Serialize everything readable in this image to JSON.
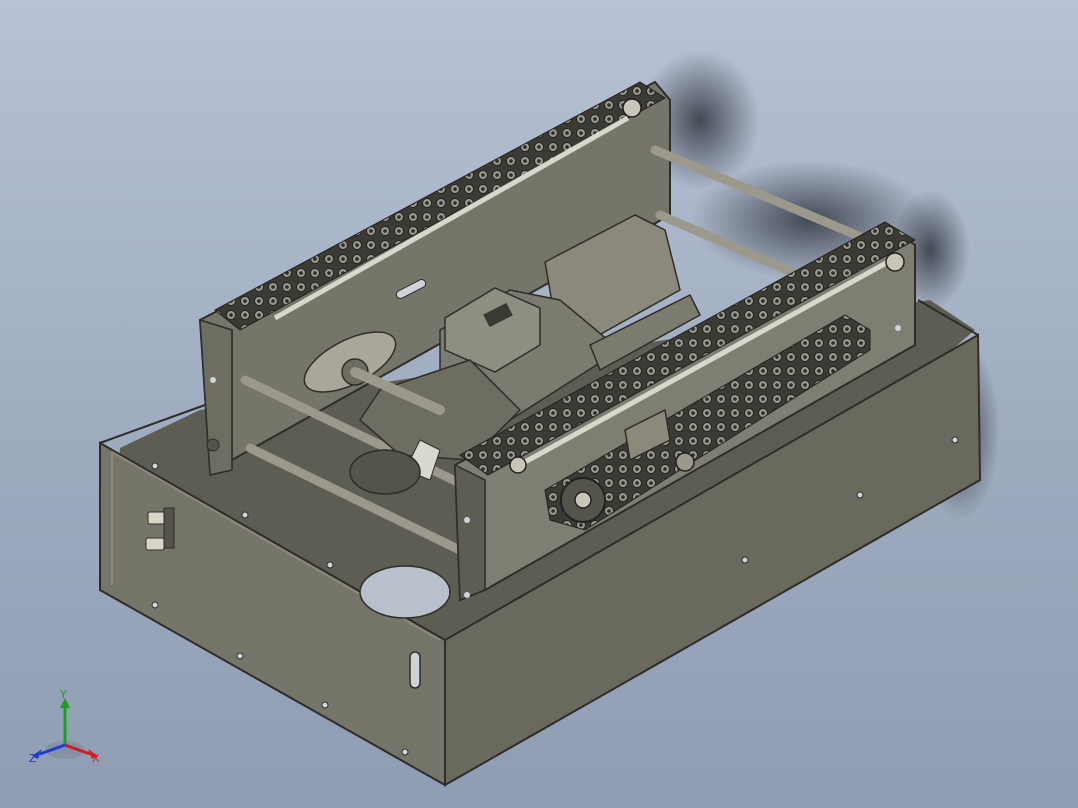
{
  "viewport": {
    "background_top": "#b7c2d4",
    "background_bottom": "#8f9db3",
    "model_color": "#6e6d62",
    "model_light": "#8a897c",
    "model_dark": "#4f4e45",
    "chain_color": "#3b3a34"
  },
  "triad": {
    "x_label": "X",
    "y_label": "Y",
    "z_label": "Z",
    "x_color": "#d21e1e",
    "y_color": "#1ea01e",
    "z_color": "#1e3cd2"
  }
}
